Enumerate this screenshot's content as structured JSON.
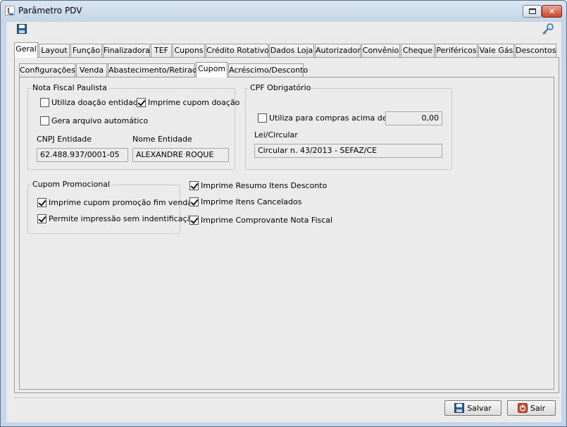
{
  "window": {
    "title": "Parâmetro PDV"
  },
  "main_tabs": [
    {
      "label": "Geral",
      "active": true
    },
    {
      "label": "Layout"
    },
    {
      "label": "Função"
    },
    {
      "label": "Finalizadora"
    },
    {
      "label": "TEF"
    },
    {
      "label": "Cupons"
    },
    {
      "label": "Crédito Rotativo"
    },
    {
      "label": "Dados Loja"
    },
    {
      "label": "Autorizador"
    },
    {
      "label": "Convênio"
    },
    {
      "label": "Cheque"
    },
    {
      "label": "Periféricos"
    },
    {
      "label": "Vale Gás"
    },
    {
      "label": "Descontos"
    }
  ],
  "sub_tabs": [
    {
      "label": "Configurações"
    },
    {
      "label": "Venda"
    },
    {
      "label": "Abastecimento/Retirada"
    },
    {
      "label": "Cupom",
      "active": true
    },
    {
      "label": "Acréscimo/Desconto"
    }
  ],
  "nota_fiscal_paulista": {
    "title": "Nota Fiscal Paulista",
    "utiliza_doacao": {
      "label": "Utiliza doação entidade",
      "checked": false
    },
    "imprime_cupom_doacao": {
      "label": "Imprime cupom doação",
      "checked": true
    },
    "gera_arquivo": {
      "label": "Gera arquivo automático",
      "checked": false
    },
    "cnpj_label": "CNPJ Entidade",
    "cnpj_value": "62.488.937/0001-05",
    "nome_label": "Nome Entidade",
    "nome_value": "ALEXANDRE ROQUE"
  },
  "cpf_obrigatorio": {
    "title": "CPF Obrigatório",
    "utiliza_compras": {
      "label": "Utiliza para compras acima de R$",
      "checked": false
    },
    "valor": "0,00",
    "lei_label": "Lei/Circular",
    "lei_value": "Circular n. 43/2013 - SEFAZ/CE"
  },
  "cupom_promocional": {
    "title": "Cupom Promocional",
    "imprime_promocao": {
      "label": "Imprime cupom promoção fim venda",
      "checked": true
    },
    "permite_impressao": {
      "label": "Permite impressão sem indentificação",
      "checked": true
    }
  },
  "options": {
    "resumo_itens": {
      "label": "Imprime Resumo Itens Desconto",
      "checked": true
    },
    "itens_cancelados": {
      "label": "Imprime Itens Cancelados",
      "checked": true
    },
    "comprovante_nf": {
      "label": "Imprime Comprovante Nota Fiscal",
      "checked": true
    }
  },
  "buttons": {
    "save": "Salvar",
    "exit": "Sair"
  },
  "icons": {
    "save": "floppy-disk-icon",
    "key": "key-icon",
    "exit": "power-icon"
  },
  "colors": {
    "title_bar": "#c9d9ea",
    "window_bg": "#ebebeb",
    "exit_icon": "#d9472b",
    "save_icon": "#2c5d9b"
  }
}
